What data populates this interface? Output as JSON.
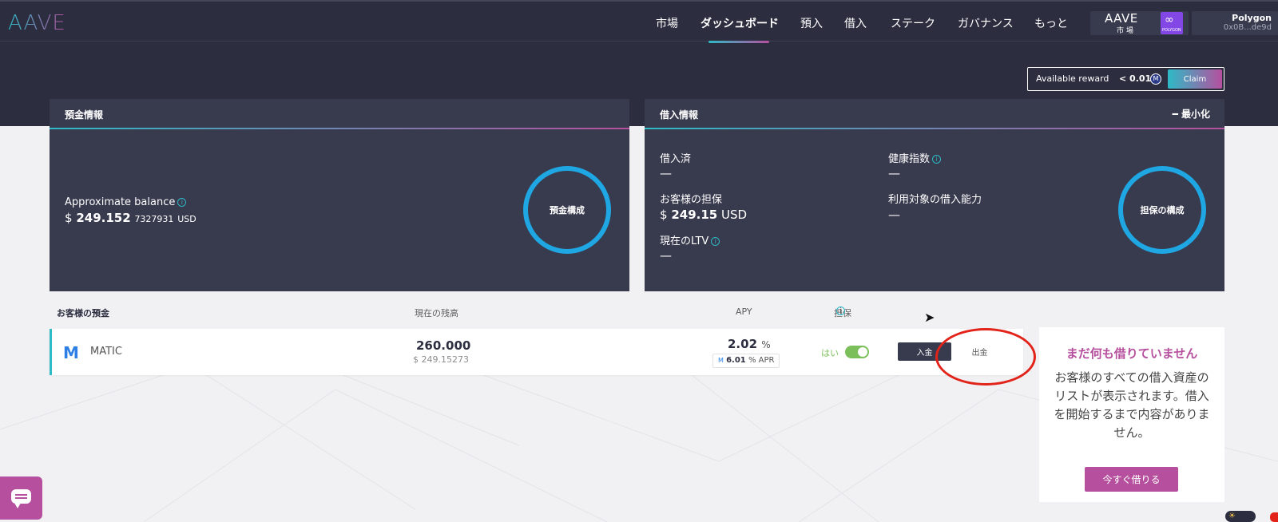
{
  "header": {
    "logo": "AAVE",
    "nav": [
      {
        "label": "市場",
        "active": false
      },
      {
        "label": "ダッシュボード",
        "active": true
      },
      {
        "label": "預入",
        "active": false
      },
      {
        "label": "借入",
        "active": false
      },
      {
        "label": "ステーク",
        "active": false
      },
      {
        "label": "ガバナンス",
        "active": false
      },
      {
        "label": "もっと",
        "active": false
      }
    ],
    "market": {
      "brand": "AAVE",
      "sub": "市場",
      "badge": "POLYGON"
    },
    "wallet": {
      "network": "Polygon",
      "address": "0x0B...de9d"
    }
  },
  "reward": {
    "label": "Available reward",
    "value": "< 0.01",
    "claim_label": "Claim"
  },
  "deposit_info": {
    "title": "預金情報",
    "balance_label": "Approximate balance",
    "balance_currency": "$",
    "balance_main": "249.152",
    "balance_decimals": "7327931",
    "balance_unit": "USD",
    "ring_label": "預金構成"
  },
  "borrow_info": {
    "title": "借入情報",
    "minimize_label": "最小化",
    "borrowed_label": "借入済",
    "borrowed_value": "—",
    "health_label": "健康指数",
    "health_value": "—",
    "collateral_label": "お客様の担保",
    "collateral_currency": "$",
    "collateral_value": "249.15",
    "collateral_unit": "USD",
    "capacity_label": "利用対象の借入能力",
    "capacity_value": "—",
    "ltv_label": "現在のLTV",
    "ltv_value": "—",
    "ring_label": "担保の構成"
  },
  "deposits": {
    "headers": {
      "asset": "お客様の預金",
      "balance": "現在の残高",
      "apy": "APY",
      "collateral": "担保"
    },
    "rows": [
      {
        "asset": "MATIC",
        "balance": "260.000",
        "balance_usd": "$ 249.15273",
        "apy": "2.02",
        "apy_unit": "%",
        "apr_value": "6.01",
        "apr_unit": "%",
        "apr_label": "APR",
        "collateral_text": "はい",
        "collateral_enabled": true,
        "deposit_label": "入金",
        "withdraw_label": "出金"
      }
    ]
  },
  "borrows_empty": {
    "title": "まだ何も借りていません",
    "description": "お客様のすべての借入資産のリストが表示されます。借入を開始するまで内容がありません。",
    "button_label": "今すぐ借りる"
  },
  "colors": {
    "bg_dark": "#2c2d3f",
    "panel": "#383a4e",
    "accent_teal": "#2ebac6",
    "accent_pink": "#b6509e",
    "ring": "#1fa7e3",
    "toggle_on": "#7bbf5a",
    "highlight_red": "#e2231a"
  }
}
